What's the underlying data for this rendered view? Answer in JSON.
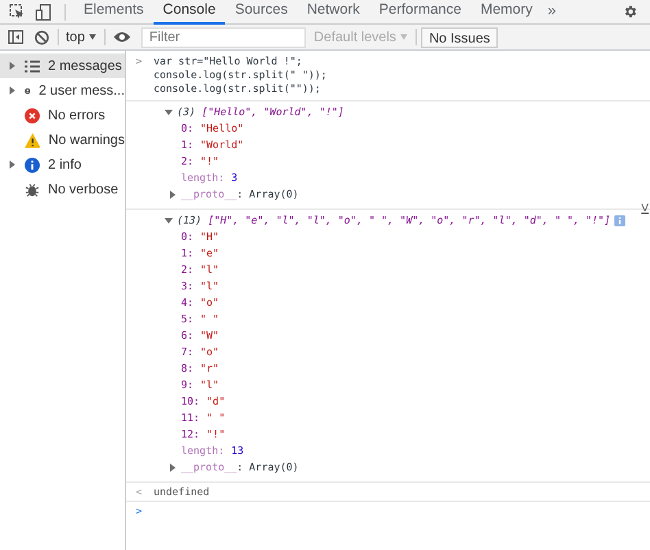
{
  "tabs": [
    {
      "label": "Elements",
      "selected": false
    },
    {
      "label": "Console",
      "selected": true
    },
    {
      "label": "Sources",
      "selected": false
    },
    {
      "label": "Network",
      "selected": false
    },
    {
      "label": "Performance",
      "selected": false
    },
    {
      "label": "Memory",
      "selected": false
    }
  ],
  "more_tabs": "»",
  "toolbar": {
    "context": "top",
    "filter": {
      "placeholder": "Filter"
    },
    "levels": "Default levels",
    "issues": "No Issues"
  },
  "sidebar": {
    "items": [
      {
        "kind": "messages",
        "label": "2 messages",
        "expandable": true,
        "selected": true
      },
      {
        "kind": "user",
        "label": "2 user mess...",
        "expandable": true,
        "selected": false
      },
      {
        "kind": "error",
        "label": "No errors",
        "expandable": false,
        "selected": false
      },
      {
        "kind": "warning",
        "label": "No warnings",
        "expandable": false,
        "selected": false
      },
      {
        "kind": "info",
        "label": "2 info",
        "expandable": true,
        "selected": false
      },
      {
        "kind": "verbose",
        "label": "No verbose",
        "expandable": false,
        "selected": false
      }
    ]
  },
  "console": {
    "input": {
      "prompt": ">",
      "lines": [
        "var str=\"Hello World !\";",
        "console.log(str.split(\" \"));",
        "console.log(str.split(\"\"));"
      ]
    },
    "logs": [
      {
        "count": "(3)",
        "preview": "[\"Hello\", \"World\", \"!\"]",
        "expanded": true,
        "entries": [
          {
            "key": "0:",
            "value": "\"Hello\""
          },
          {
            "key": "1:",
            "value": "\"World\""
          },
          {
            "key": "2:",
            "value": "\"!\""
          }
        ],
        "length_key": "length:",
        "length": "3",
        "proto_key": "__proto__",
        "proto": ": Array(0)"
      },
      {
        "count": "(13)",
        "preview": "[\"H\", \"e\", \"l\", \"l\", \"o\", \" \", \"W\", \"o\", \"r\", \"l\", \"d\", \" \", \"!\"]",
        "source": "V",
        "expanded": true,
        "entries": [
          {
            "key": "0:",
            "value": "\"H\""
          },
          {
            "key": "1:",
            "value": "\"e\""
          },
          {
            "key": "2:",
            "value": "\"l\""
          },
          {
            "key": "3:",
            "value": "\"l\""
          },
          {
            "key": "4:",
            "value": "\"o\""
          },
          {
            "key": "5:",
            "value": "\" \""
          },
          {
            "key": "6:",
            "value": "\"W\""
          },
          {
            "key": "7:",
            "value": "\"o\""
          },
          {
            "key": "8:",
            "value": "\"r\""
          },
          {
            "key": "9:",
            "value": "\"l\""
          },
          {
            "key": "10:",
            "value": "\"d\""
          },
          {
            "key": "11:",
            "value": "\" \""
          },
          {
            "key": "12:",
            "value": "\"!\""
          }
        ],
        "length_key": "length:",
        "length": "13",
        "proto_key": "__proto__",
        "proto": ": Array(0)"
      }
    ],
    "result": {
      "marker": "<",
      "value": "undefined"
    },
    "prompt": ">"
  }
}
